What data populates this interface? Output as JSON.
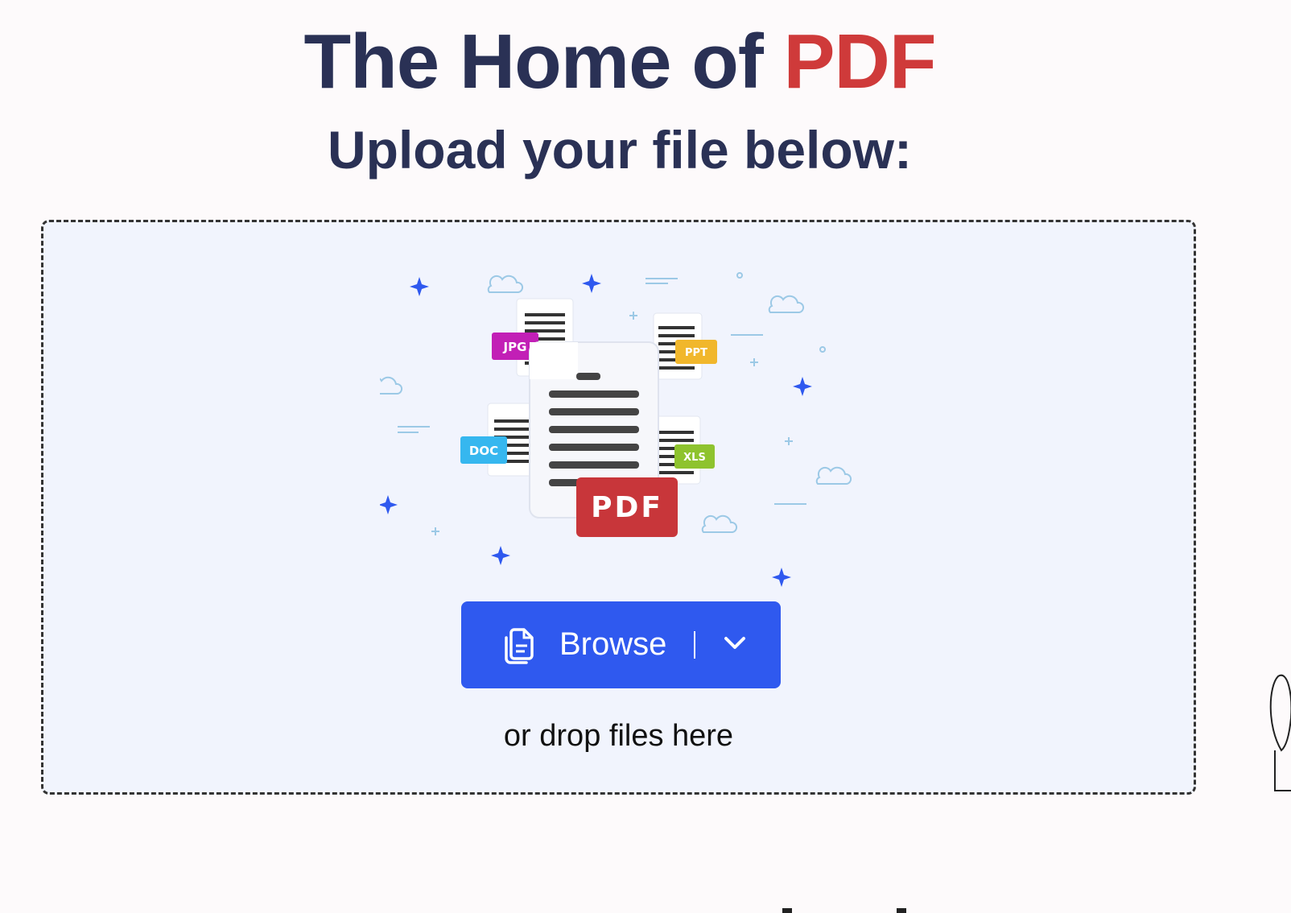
{
  "hero": {
    "title_prefix": "The Home of ",
    "title_accent": "PDF",
    "subtitle": "Upload your file below:"
  },
  "upload": {
    "browse_label": "Browse",
    "drop_hint": "or drop files here",
    "illustration_badges": {
      "jpg": "JPG",
      "ppt": "PPT",
      "doc": "DOC",
      "xls": "XLS",
      "pdf": "PDF"
    }
  },
  "colors": {
    "title": "#2a3155",
    "accent": "#cf3a3a",
    "button": "#2f59ef",
    "dropzone_bg": "#f1f4fd"
  },
  "icons": {
    "browse": "files-icon",
    "dropdown": "chevron-down-icon"
  }
}
